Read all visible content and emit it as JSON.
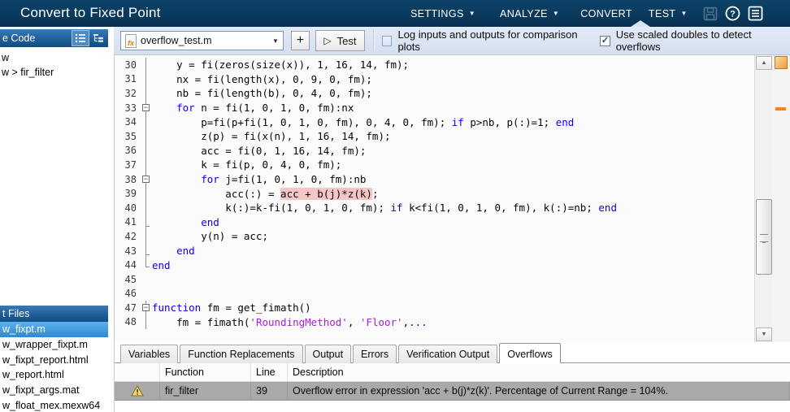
{
  "app": {
    "title": "Convert to Fixed Point",
    "menus": [
      {
        "label": "SETTINGS",
        "dropdown": true
      },
      {
        "label": "ANALYZE",
        "dropdown": true
      },
      {
        "label": "CONVERT",
        "dropdown": false
      },
      {
        "label": "TEST",
        "dropdown": true
      }
    ],
    "window_icons": [
      "save-icon",
      "help-icon",
      "menu-icon"
    ]
  },
  "toolbar": {
    "file_selector_value": "overflow_test.m",
    "add_button_label": "+",
    "test_button_label": "Test",
    "play_glyph": "▷",
    "checkbox_log": {
      "label": "Log inputs and outputs for comparison plots",
      "checked": false
    },
    "checkbox_scaled": {
      "label": "Use scaled doubles to detect overflows",
      "checked": true
    }
  },
  "sidebar": {
    "source_header": "e Code",
    "tree_items": [
      "w",
      "w > fir_filter"
    ],
    "files_header": "t Files",
    "files": [
      {
        "name": "w_fixpt.m",
        "selected": true
      },
      {
        "name": "w_wrapper_fixpt.m",
        "selected": false
      },
      {
        "name": "w_fixpt_report.html",
        "selected": false
      },
      {
        "name": "w_report.html",
        "selected": false
      },
      {
        "name": "w_fixpt_args.mat",
        "selected": false
      },
      {
        "name": "w_float_mex.mexw64",
        "selected": false
      }
    ]
  },
  "editor": {
    "overflow_marker_color": "#ff8400",
    "highlight_color": "#f6c6c6",
    "lines": [
      {
        "n": 30,
        "fold": "line",
        "segs": [
          {
            "t": "    y = fi(zeros(size(x)), 1, 16, 14, fm);"
          }
        ]
      },
      {
        "n": 31,
        "fold": "line",
        "segs": [
          {
            "t": "    nx = fi(length(x), 0, 9, 0, fm);"
          }
        ]
      },
      {
        "n": 32,
        "fold": "line",
        "segs": [
          {
            "t": "    nb = fi(length(b), 0, 4, 0, fm);"
          }
        ]
      },
      {
        "n": 33,
        "fold": "box",
        "segs": [
          {
            "t": "    "
          },
          {
            "t": "for",
            "c": "kw"
          },
          {
            "t": " n = fi(1, 0, 1, 0, fm):nx"
          }
        ]
      },
      {
        "n": 34,
        "fold": "line",
        "segs": [
          {
            "t": "        p=fi(p+fi(1, 0, 1, 0, fm), 0, 4, 0, fm); "
          },
          {
            "t": "if",
            "c": "kw"
          },
          {
            "t": " p>nb, p(:)=1; "
          },
          {
            "t": "end",
            "c": "kw"
          }
        ]
      },
      {
        "n": 35,
        "fold": "line",
        "segs": [
          {
            "t": "        z(p) = fi(x(n), 1, 16, 14, fm);"
          }
        ]
      },
      {
        "n": 36,
        "fold": "line",
        "segs": [
          {
            "t": "        acc = fi(0, 1, 16, 14, fm);"
          }
        ]
      },
      {
        "n": 37,
        "fold": "line",
        "segs": [
          {
            "t": "        k = fi(p, 0, 4, 0, fm);"
          }
        ]
      },
      {
        "n": 38,
        "fold": "box",
        "segs": [
          {
            "t": "        "
          },
          {
            "t": "for",
            "c": "kw"
          },
          {
            "t": " j=fi(1, 0, 1, 0, fm):nb"
          }
        ]
      },
      {
        "n": 39,
        "fold": "line",
        "segs": [
          {
            "t": "            acc(:) = "
          },
          {
            "t": "acc + b(j)*z(k)",
            "c": "hl"
          },
          {
            "t": ";"
          }
        ]
      },
      {
        "n": 40,
        "fold": "line",
        "segs": [
          {
            "t": "            k(:)=k-fi(1, 0, 1, 0, fm); "
          },
          {
            "t": "if",
            "c": "kw"
          },
          {
            "t": " k<fi(1, 0, 1, 0, fm), k(:)=nb; "
          },
          {
            "t": "end",
            "c": "kw"
          }
        ]
      },
      {
        "n": 41,
        "fold": "tick",
        "segs": [
          {
            "t": "        "
          },
          {
            "t": "end",
            "c": "kw"
          }
        ]
      },
      {
        "n": 42,
        "fold": "line",
        "segs": [
          {
            "t": "        y(n) = acc;"
          }
        ]
      },
      {
        "n": 43,
        "fold": "tick",
        "segs": [
          {
            "t": "    "
          },
          {
            "t": "end",
            "c": "kw"
          }
        ]
      },
      {
        "n": 44,
        "fold": "end",
        "segs": [
          {
            "t": "end",
            "c": "kw"
          }
        ]
      },
      {
        "n": 45,
        "fold": "",
        "segs": []
      },
      {
        "n": 46,
        "fold": "",
        "segs": []
      },
      {
        "n": 47,
        "fold": "box",
        "segs": [
          {
            "t": "function",
            "c": "kw"
          },
          {
            "t": " fm = get_fimath()"
          }
        ]
      },
      {
        "n": 48,
        "fold": "line",
        "segs": [
          {
            "t": "    fm = fimath("
          },
          {
            "t": "'RoundingMethod'",
            "c": "str"
          },
          {
            "t": ", "
          },
          {
            "t": "'Floor'",
            "c": "str"
          },
          {
            "t": ","
          },
          {
            "t": "...",
            "c": "kw"
          }
        ]
      }
    ]
  },
  "bottom": {
    "tabs": [
      {
        "label": "Variables",
        "active": false
      },
      {
        "label": "Function Replacements",
        "active": false
      },
      {
        "label": "Output",
        "active": false
      },
      {
        "label": "Errors",
        "active": false
      },
      {
        "label": "Verification Output",
        "active": false
      },
      {
        "label": "Overflows",
        "active": true
      }
    ],
    "columns": [
      "Function",
      "Line",
      "Description"
    ],
    "rows": [
      {
        "icon": "warning",
        "function": "fir_filter",
        "line": "39",
        "description": "Overflow error in expression 'acc + b(j)*z(k)'. Percentage of Current Range = 104%.",
        "selected": true
      }
    ]
  },
  "colors": {
    "topbar_blue": "#0a3a5e",
    "panel_header_blue": "#1c5c95",
    "selection_blue": "#2f89d3",
    "overflow_orange": "#ff8400",
    "highlight_pink": "#f6c6c6",
    "selected_row_gray": "#a9a9a9"
  }
}
